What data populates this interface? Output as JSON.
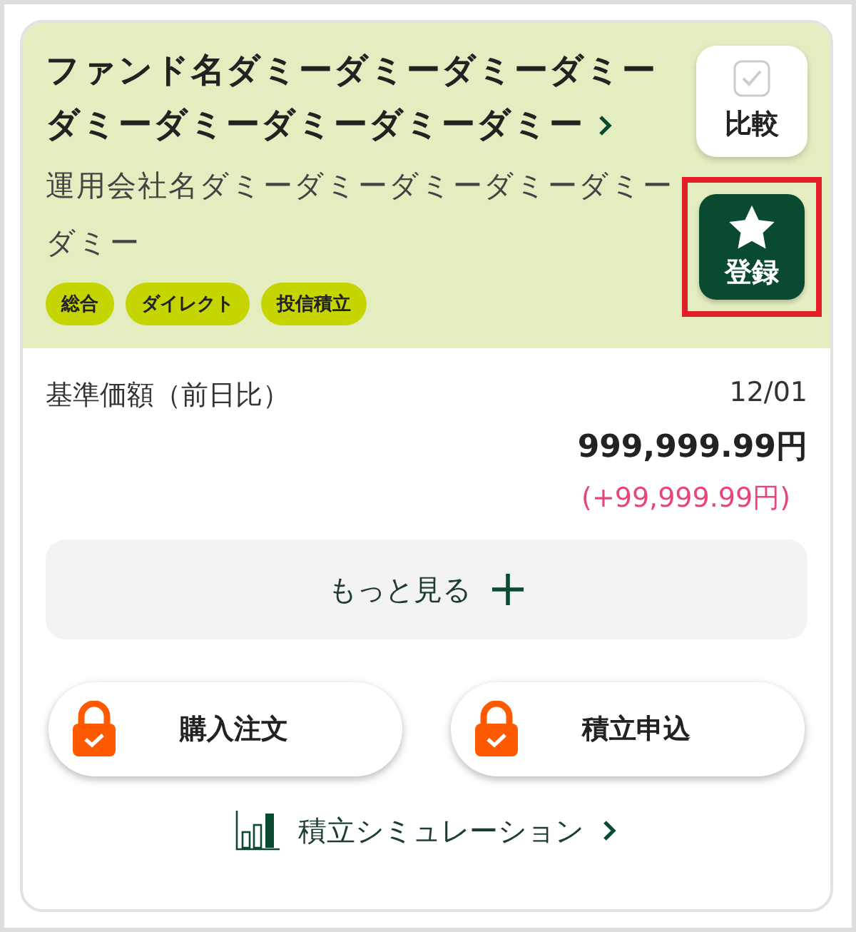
{
  "fund": {
    "name": "ファンド名ダミーダミーダミーダミーダミーダミーダミーダミーダミー",
    "company": "運用会社名ダミーダミーダミーダミーダミーダミー",
    "tags": [
      "総合",
      "ダイレクト",
      "投信積立"
    ]
  },
  "compare": {
    "label": "比較",
    "checked": false
  },
  "register": {
    "label": "登録",
    "highlighted": true
  },
  "price": {
    "label": "基準価額（前日比）",
    "date": "12/01",
    "value": "999,999.99円",
    "change": "(+99,999.99円)"
  },
  "more_button": "もっと見る",
  "actions": [
    "購入注文",
    "積立申込"
  ],
  "simulation_link": "積立シミュレーション"
}
